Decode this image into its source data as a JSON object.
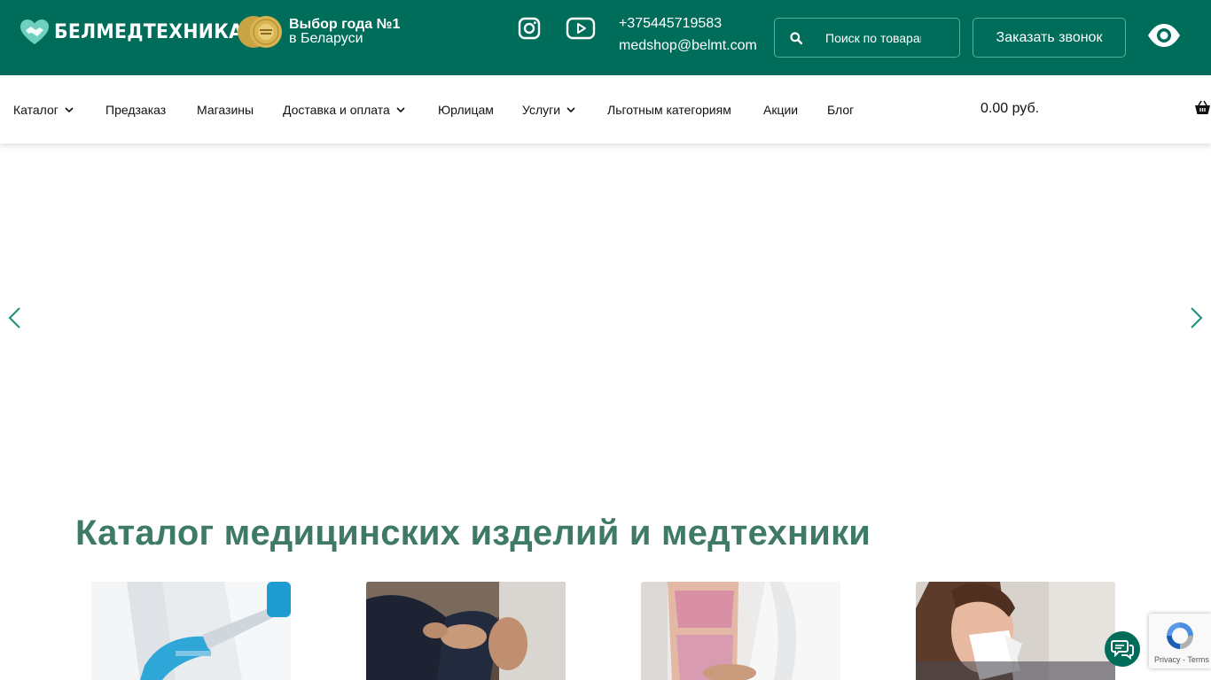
{
  "header": {
    "brand": "БЕЛМЕДТЕХНИКА",
    "award_line1": "Выбор года №1",
    "award_line2": "в Беларуси",
    "phone": "+375445719583",
    "email": "medshop@belmt.com",
    "search_placeholder": "Поиск по товарам",
    "callback_label": "Заказать звонок",
    "social_icons": [
      "instagram-icon",
      "youtube-icon"
    ],
    "accessibility_icon": "eye-icon"
  },
  "nav": {
    "items": [
      {
        "label": "Каталог",
        "has_dropdown": true
      },
      {
        "label": "Предзаказ",
        "has_dropdown": false
      },
      {
        "label": "Магазины",
        "has_dropdown": false
      },
      {
        "label": "Доставка и оплата",
        "has_dropdown": true
      },
      {
        "label": "Юрлицам",
        "has_dropdown": false
      },
      {
        "label": "Услуги",
        "has_dropdown": true
      },
      {
        "label": "Льготным категориям",
        "has_dropdown": false
      },
      {
        "label": "Акции",
        "has_dropdown": false
      },
      {
        "label": "Блог",
        "has_dropdown": false
      }
    ],
    "cart_total": "0.00 руб."
  },
  "catalog": {
    "title": "Каталог медицинских изделий и медтехники",
    "cards": [
      {
        "image": "lab-test-photo"
      },
      {
        "image": "knee-pain-photo"
      },
      {
        "image": "massage-photo"
      },
      {
        "image": "woman-sneezing-photo"
      }
    ]
  },
  "recaptcha": {
    "links": "Privacy - Terms"
  },
  "colors": {
    "brand_green": "#006c5a",
    "title_green": "#3e7a64",
    "accent_teal": "#1a8f7a"
  }
}
